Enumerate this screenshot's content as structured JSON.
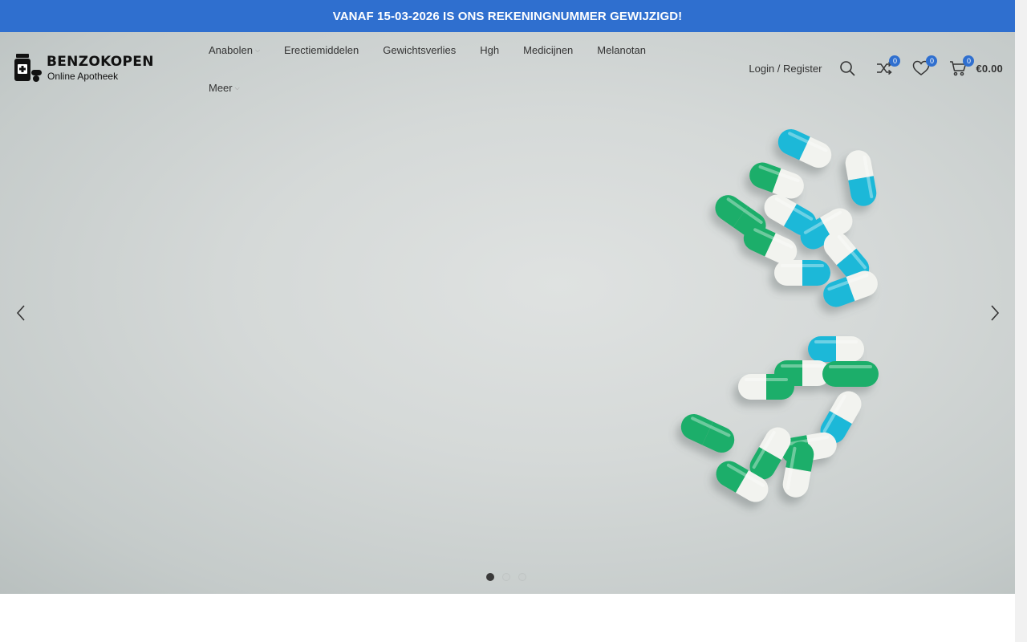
{
  "announcement": "VANAF 15-03-2026 IS ONS REKENINGNUMMER GEWIJZIGD!",
  "logo": {
    "title": "BENZOKOPEN",
    "subtitle": "Online Apotheek"
  },
  "nav": [
    {
      "label": "Anabolen",
      "dropdown": true
    },
    {
      "label": "Erectiemiddelen",
      "dropdown": false
    },
    {
      "label": "Gewichtsverlies",
      "dropdown": false
    },
    {
      "label": "Hgh",
      "dropdown": false
    },
    {
      "label": "Medicijnen",
      "dropdown": false
    },
    {
      "label": "Melanotan",
      "dropdown": false
    },
    {
      "label": "Meer",
      "dropdown": true
    }
  ],
  "header": {
    "login_label": "Login / Register",
    "compare_count": "0",
    "wishlist_count": "0",
    "cart_count": "0",
    "cart_total": "€0.00"
  },
  "slider": {
    "slide_count": 3,
    "active_index": 0
  },
  "colors": {
    "accent": "#2f6fcf",
    "pill_teal": "#1fb8d8",
    "pill_green": "#1fae6a",
    "pill_white": "#f2f3ef"
  },
  "icons": [
    "search-icon",
    "compare-icon",
    "heart-icon",
    "cart-icon",
    "chevron-left-icon",
    "chevron-right-icon"
  ]
}
